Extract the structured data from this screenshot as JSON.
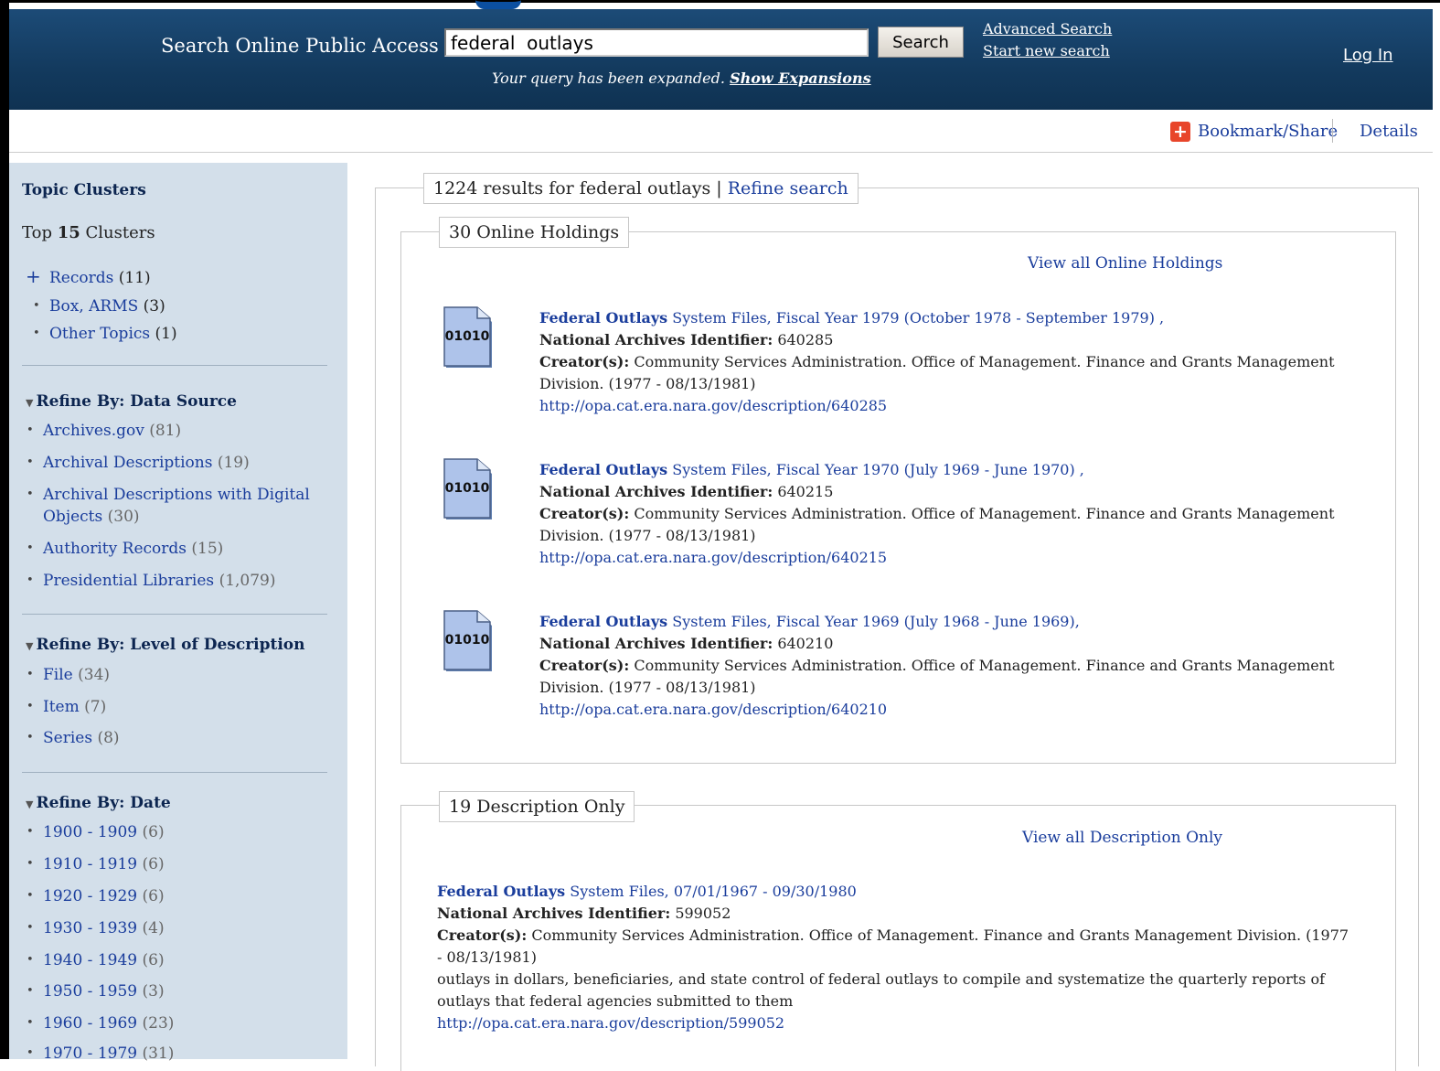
{
  "header": {
    "search_label": "Search Online Public Access",
    "search_value": "federal  outlays",
    "search_button": "Search",
    "expansion_text": "Your query has been expanded.",
    "expansion_link": "Show Expansions",
    "advanced_search": "Advanced Search",
    "start_new_search": "Start new search",
    "login": "Log In"
  },
  "utility": {
    "bookmark_icon": "+",
    "bookmark_label": "Bookmark/Share",
    "details_label": "Details"
  },
  "sidebar": {
    "topic_heading": "Topic Clusters",
    "top_prefix": "Top",
    "top_count": "15",
    "top_suffix": "Clusters",
    "clusters": [
      {
        "label": "Records",
        "count": "(11)"
      },
      {
        "label": "Box, ARMS",
        "count": "(3)"
      },
      {
        "label": "Other Topics",
        "count": "(1)"
      }
    ],
    "data_source": {
      "heading": "Refine By: Data Source",
      "items": [
        {
          "label": "Archives.gov",
          "count": "(81)"
        },
        {
          "label": "Archival Descriptions",
          "count": "(19)"
        },
        {
          "label": "Archival Descriptions with Digital",
          "label2": "Objects",
          "count": "(30)"
        },
        {
          "label": "Authority Records",
          "count": "(15)"
        },
        {
          "label": "Presidential Libraries",
          "count": "(1,079)"
        }
      ]
    },
    "level": {
      "heading": "Refine By: Level of Description",
      "items": [
        {
          "label": "File",
          "count": "(34)"
        },
        {
          "label": "Item",
          "count": "(7)"
        },
        {
          "label": "Series",
          "count": "(8)"
        }
      ]
    },
    "date": {
      "heading": "Refine By: Date",
      "items": [
        {
          "label": "1900 - 1909",
          "count": "(6)"
        },
        {
          "label": "1910 - 1919",
          "count": "(6)"
        },
        {
          "label": "1920 - 1929",
          "count": "(6)"
        },
        {
          "label": "1930 - 1939",
          "count": "(4)"
        },
        {
          "label": "1940 - 1949",
          "count": "(6)"
        },
        {
          "label": "1950 - 1959",
          "count": "(3)"
        },
        {
          "label": "1960 - 1969",
          "count": "(23)"
        },
        {
          "label": "1970 - 1979",
          "count": "(31)"
        }
      ]
    }
  },
  "results": {
    "summary": "1224 results for federal outlays |",
    "refine_link": "Refine search",
    "online": {
      "legend": "30 Online Holdings",
      "view_all": "View all Online Holdings",
      "items": [
        {
          "icon_text": "01010",
          "title_bold": "Federal Outlays",
          "title_rest": " System Files, Fiscal Year 1979 (October 1978 - September 1979) ,",
          "nai_label": "National Archives Identifier:",
          "nai_value": " 640285",
          "creator_label": "Creator(s):",
          "creator_value": " Community Services Administration. Office of Management. Finance and Grants Management Division. (1977 - 08/13/1981)",
          "url": "http://opa.cat.era.nara.gov/description/640285"
        },
        {
          "icon_text": "01010",
          "title_bold": "Federal Outlays",
          "title_rest": " System Files, Fiscal Year 1970 (July 1969 - June 1970) ,",
          "nai_label": "National Archives Identifier:",
          "nai_value": " 640215",
          "creator_label": "Creator(s):",
          "creator_value": " Community Services Administration. Office of Management. Finance and Grants Management Division. (1977 - 08/13/1981)",
          "url": "http://opa.cat.era.nara.gov/description/640215"
        },
        {
          "icon_text": "01010",
          "title_bold": "Federal Outlays",
          "title_rest": " System Files, Fiscal Year 1969 (July 1968 - June 1969),",
          "nai_label": "National Archives Identifier:",
          "nai_value": " 640210",
          "creator_label": "Creator(s):",
          "creator_value": " Community Services Administration. Office of Management. Finance and Grants Management Division. (1977 - 08/13/1981)",
          "url": "http://opa.cat.era.nara.gov/description/640210"
        }
      ]
    },
    "description": {
      "legend": "19 Description Only",
      "view_all": "View all Description Only",
      "item": {
        "title_bold": "Federal Outlays",
        "title_rest": " System Files, 07/01/1967 - 09/30/1980",
        "nai_label": "National Archives Identifier:",
        "nai_value": " 599052",
        "creator_label": "Creator(s):",
        "creator_value": " Community Services Administration. Office of Management. Finance and Grants Management Division. (1977 - 08/13/1981)",
        "snippet": "outlays in dollars, beneficiaries, and state control of federal outlays to compile and systematize the quarterly reports of outlays that federal agencies submitted to them",
        "url": "http://opa.cat.era.nara.gov/description/599052"
      }
    }
  },
  "colors": {
    "header_bg": "#133a5e",
    "sidebar_bg": "#d3dfea",
    "link": "#1a3d9c",
    "bookmark_accent": "#e8452a"
  }
}
